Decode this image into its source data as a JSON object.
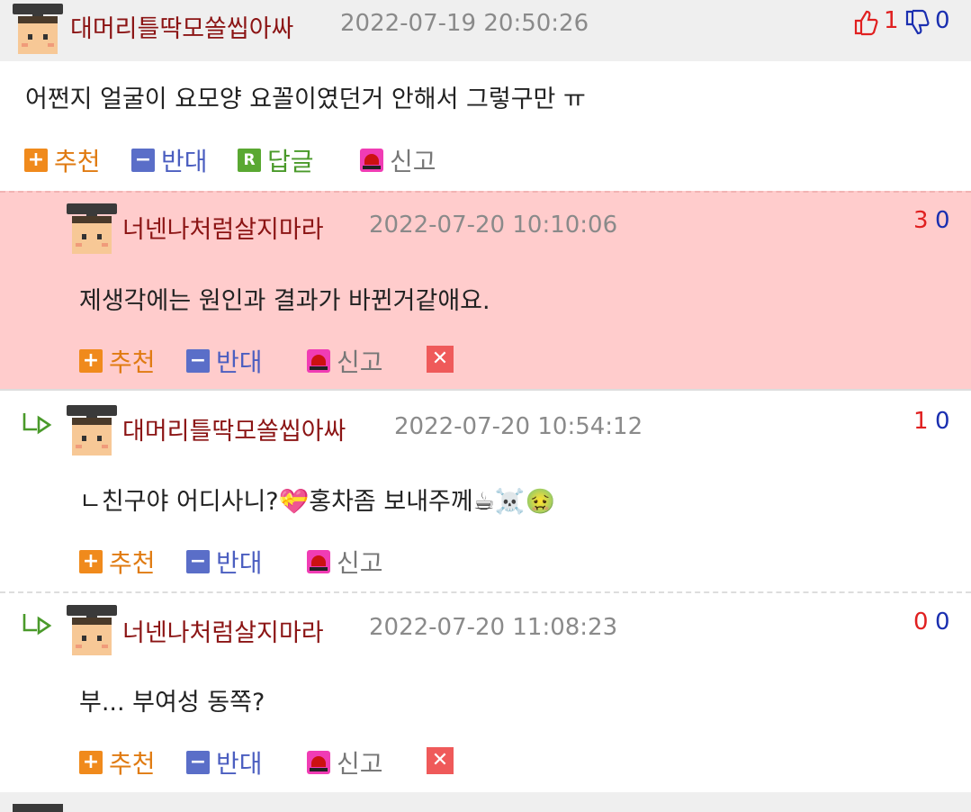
{
  "comments": [
    {
      "nick": "대머리틀딱모쏠씹아싸",
      "time": "2022-07-19 20:50:26",
      "text": "어쩐지 얼굴이 요모양 요꼴이였던거 안해서 그렇구만 ㅠ",
      "up": "1",
      "down": "0",
      "actions": {
        "recommend": "추천",
        "oppose": "반대",
        "reply": "답글",
        "report": "신고"
      }
    },
    {
      "nick": "너넨나처럼살지마라",
      "time": "2022-07-20 10:10:06",
      "text": "제생각에는 원인과 결과가 바뀐거같애요.",
      "up": "3",
      "down": "0",
      "actions": {
        "recommend": "추천",
        "oppose": "반대",
        "report": "신고",
        "delete": "✕"
      }
    },
    {
      "nick": "대머리틀딱모쏠씹아싸",
      "time": "2022-07-20 10:54:12",
      "text": "ㄴ친구야 어디사니?💝홍차좀 보내주께☕☠️🤢",
      "up": "1",
      "down": "0",
      "actions": {
        "recommend": "추천",
        "oppose": "반대",
        "report": "신고"
      }
    },
    {
      "nick": "너넨나처럼살지마라",
      "time": "2022-07-20 11:08:23",
      "text": "부... 부여성 동쪽?",
      "up": "0",
      "down": "0",
      "actions": {
        "recommend": "추천",
        "oppose": "반대",
        "report": "신고",
        "delete": "✕"
      }
    }
  ],
  "colors": {
    "header_bg": "#efefef",
    "highlight_bg": "#ffcccc",
    "nick": "#8b1414",
    "up": "#e02020",
    "down": "#1a2fb0"
  }
}
